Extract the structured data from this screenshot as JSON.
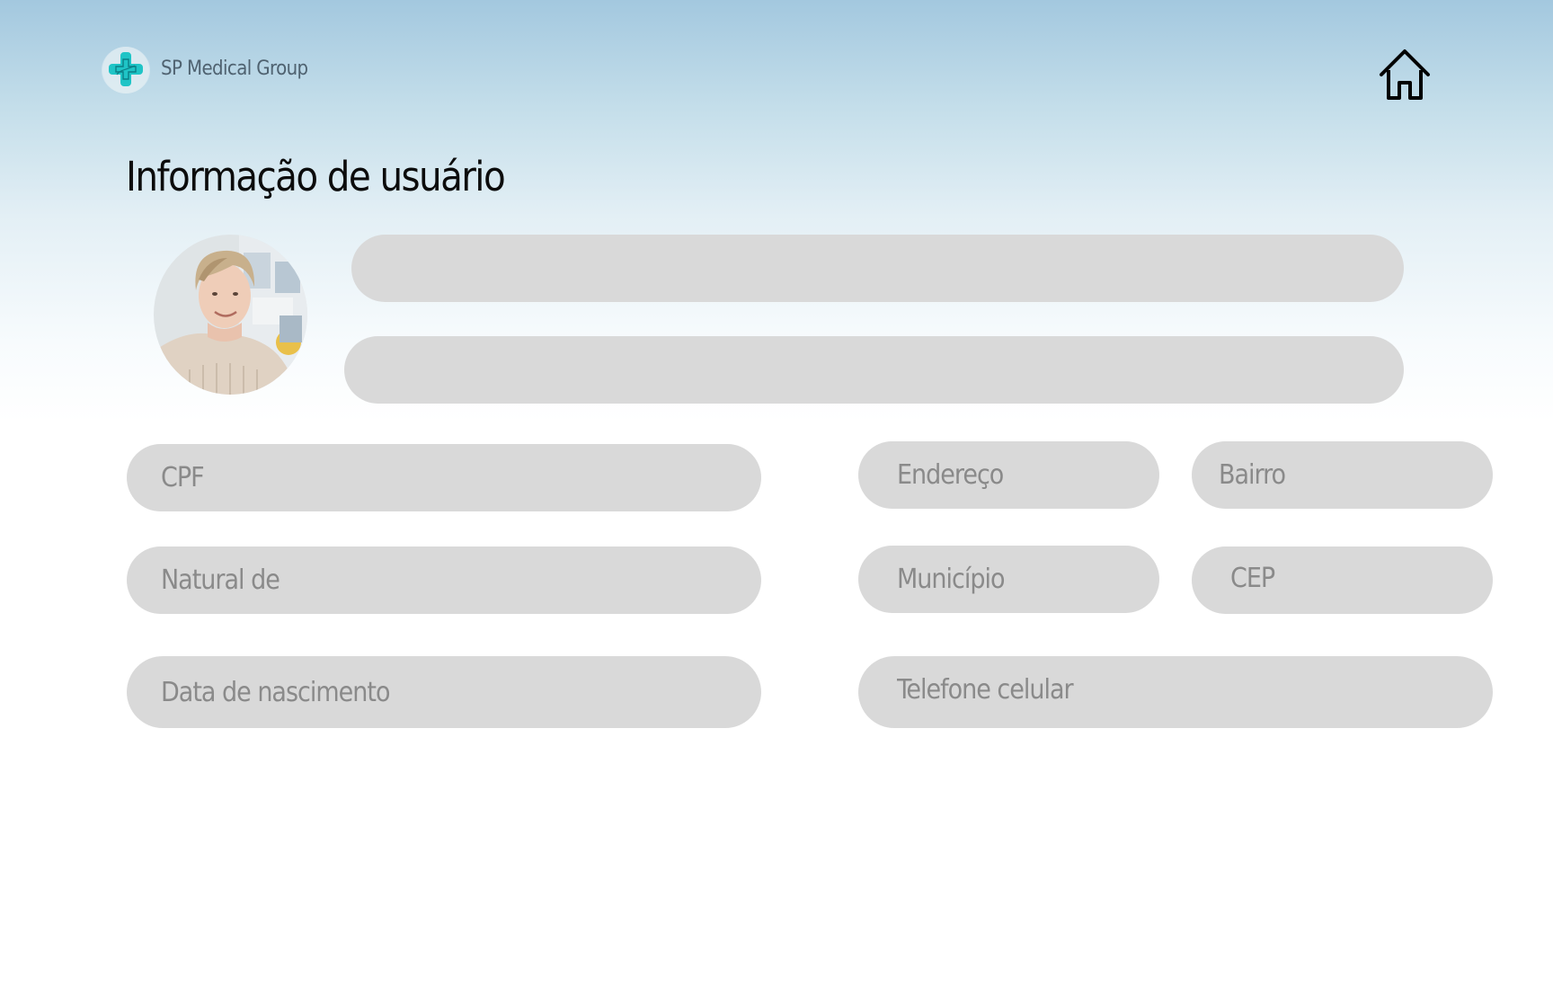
{
  "header": {
    "brand": "SP Medical Group",
    "logo_icon": "medical-cross-logo-icon",
    "home_icon": "home-icon"
  },
  "page": {
    "title": "Informação de usuário"
  },
  "profile": {
    "avatar_icon": "user-photo"
  },
  "form": {
    "name": {
      "value": "",
      "placeholder": ""
    },
    "second_line": {
      "value": "",
      "placeholder": ""
    },
    "cpf": {
      "value": "",
      "placeholder": "CPF"
    },
    "natural_de": {
      "value": "",
      "placeholder": "Natural de"
    },
    "data_nascimento": {
      "value": "",
      "placeholder": "Data de nascimento"
    },
    "endereco": {
      "value": "",
      "placeholder": "Endereço"
    },
    "bairro": {
      "value": "",
      "placeholder": "Bairro"
    },
    "municipio": {
      "value": "",
      "placeholder": "Município"
    },
    "cep": {
      "value": "",
      "placeholder": "CEP"
    },
    "telefone_celular": {
      "value": "",
      "placeholder": "Telefone celular"
    }
  },
  "colors": {
    "field_bg": "#d9d9d9",
    "placeholder": "#8a8a8a",
    "accent": "#1fc4c6",
    "gradient_top": "#a3c8df"
  }
}
